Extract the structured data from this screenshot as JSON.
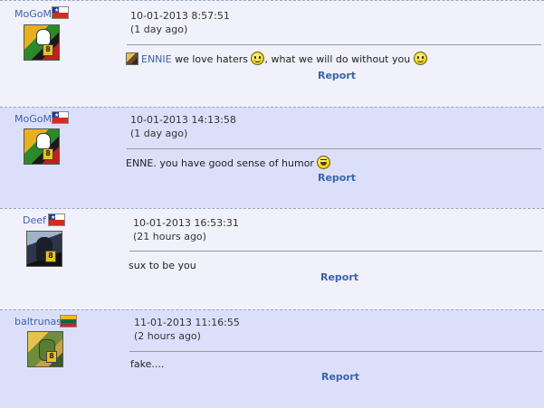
{
  "posts": [
    {
      "user": "MoGoM",
      "flag": "chile-flag",
      "avatar_icon": "popeye-avatar-icon",
      "timestamp": "10-01-2013 8:57:51",
      "ago": "(1 day ago)",
      "message_parts": {
        "mention": "ENNIE",
        "text1": " we love haters ",
        "text2": ", what we will do without you "
      },
      "report_label": "Report"
    },
    {
      "user": "MoGoM",
      "flag": "chile-flag",
      "avatar_icon": "popeye-avatar-icon",
      "timestamp": "10-01-2013 14:13:58",
      "ago": "(1 day ago)",
      "message": "ENNE. you have good sense of humor ",
      "report_label": "Report"
    },
    {
      "user": "Deef",
      "flag": "chile-flag",
      "avatar_icon": "soldier-avatar-icon",
      "timestamp": "10-01-2013 16:53:31",
      "ago": "(21 hours ago)",
      "message": "sux to be you",
      "report_label": "Report"
    },
    {
      "user": "baltrunas",
      "flag": "lithuania-flag",
      "avatar_icon": "warrior-avatar-icon",
      "timestamp": "11-01-2013 11:16:55",
      "ago": "(2 hours ago)",
      "message": "fake....",
      "report_label": "Report"
    }
  ],
  "colors": {
    "link": "#3b63ad",
    "row_light": "#f0f1fa",
    "row_dark": "#dcdffa"
  }
}
